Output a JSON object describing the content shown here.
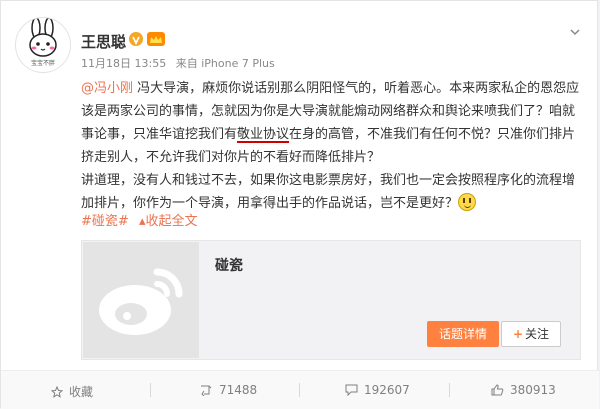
{
  "post": {
    "user_name": "王思聪",
    "meta": {
      "time": "11月18日 13:55",
      "from_label": "来自",
      "device": "iPhone 7 Plus"
    },
    "avatar_caption": "宝宝不胖",
    "body": {
      "mention": "@冯小刚",
      "part1": " 冯大导演，麻烦你说话别那么阴阳怪气的，听着恶心。本来两家私企的恩怨应该是两家公司的事情，怎就因为你是大导演就能煽动网络群众和舆论来喷我们了？咱就事论事，只准华谊挖我们有",
      "underlined": "敬业协议",
      "part2": "在身的高管，不准我们有任何不悦？只准你们排片挤走别人，不允许我们对你片的不看好而降低排片？",
      "part3": "讲道理，没有人和钱过不去，如果你这电影票房好，我们也一定会按照程序化的流程增加排片，你作为一个导演，用拿得出手的作品说话，岂不是更好？"
    },
    "tag": "#碰瓷#",
    "collapse_label": "收起全文",
    "topic_card": {
      "title": "碰瓷",
      "detail_button": "话题详情",
      "follow_button": "关注"
    },
    "actions": {
      "favorite": "收藏",
      "repost_count": "71488",
      "comment_count": "192607",
      "like_count": "380913"
    },
    "colors": {
      "link": "#eb7350",
      "accent_button": "#ff8140",
      "underline_mark": "#d10000"
    }
  }
}
